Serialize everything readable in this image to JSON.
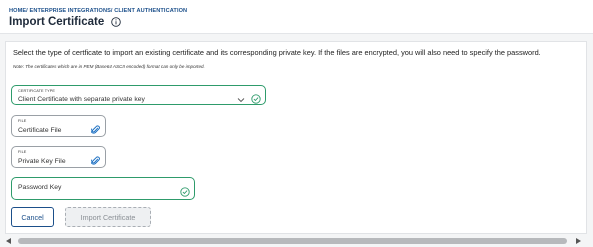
{
  "header": {
    "breadcrumb": "HOME/ ENTERPRISE INTEGRATIONS/ CLIENT AUTHENTICATION",
    "title": "Import Certificate",
    "info_icon": "info-circle-icon"
  },
  "form": {
    "description": "Select the type of certficate to import an existing certificate and its corresponding private key. If the files are encrypted, you will also need to specify the password.",
    "note": "Note: The certificates which are in PEM (Base64 ASCII encoded) format can only be imported.",
    "certificate_type": {
      "label": "CERTIFICATE TYPE",
      "value": "Client Certificate with separate private key",
      "icons": [
        "chevron-down-icon",
        "check-circle-icon"
      ]
    },
    "certificate_file": {
      "label": "FILE",
      "placeholder": "Certificate File",
      "icon": "paperclip-icon"
    },
    "private_key_file": {
      "label": "FILE",
      "placeholder": "Private Key File",
      "icon": "paperclip-icon"
    },
    "password": {
      "placeholder": "Password Key",
      "icon": "check-circle-icon"
    },
    "buttons": {
      "cancel": "Cancel",
      "import": "Import Certificate"
    }
  },
  "colors": {
    "accent": "#1b4f8a",
    "valid": "#2e9b6b",
    "page_background": "#f4f5f6"
  }
}
